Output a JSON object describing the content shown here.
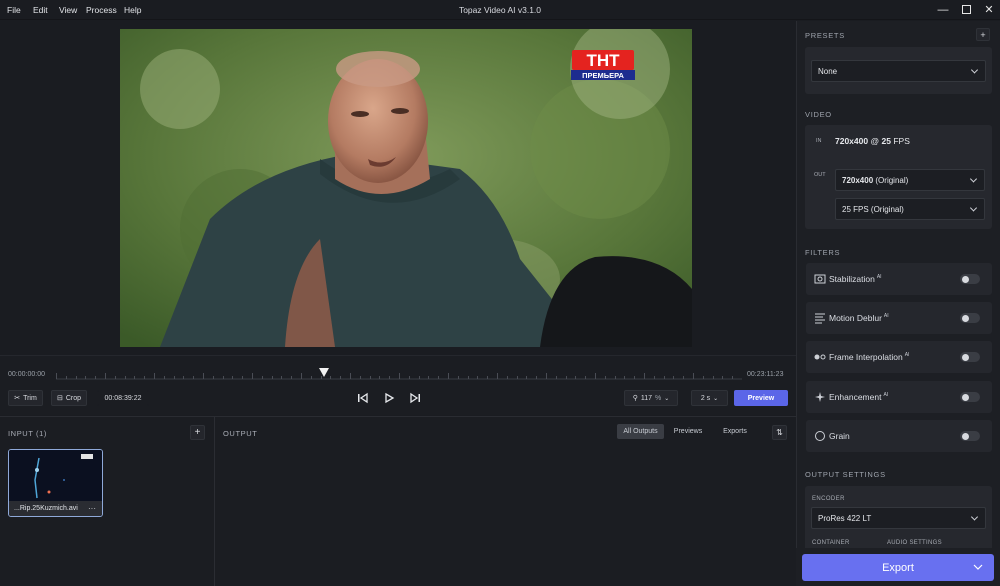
{
  "menu": {
    "file": "File",
    "edit": "Edit",
    "view": "View",
    "process": "Process",
    "help": "Help"
  },
  "app": {
    "title": "Topaz Video AI  v3.1.0"
  },
  "video_overlay": {
    "logo_text": "ТНТ",
    "logo_sub": "ПРЕМЬЕРА"
  },
  "timeline": {
    "start": "00:00:00:00",
    "end": "00:23:11:23",
    "playhead_fraction": 0.39
  },
  "toolbar": {
    "trim": "Trim",
    "crop": "Crop",
    "timecode": "00:08:39:22",
    "zoom": "117",
    "zoom_unit": "%",
    "duration": "2 s",
    "preview": "Preview"
  },
  "input": {
    "title": "INPUT (1)",
    "file_name": "...Rip.25Kuzmich.avi",
    "more": "···"
  },
  "output": {
    "title": "OUTPUT",
    "tabs": [
      "All Outputs",
      "Previews",
      "Exports"
    ]
  },
  "sidebar": {
    "presets": {
      "title": "PRESETS",
      "value": "None"
    },
    "video": {
      "title": "VIDEO",
      "in_label": "IN",
      "in_res": "720x400",
      "in_at": "@",
      "in_fps": "25",
      "in_fps_unit": "FPS",
      "out_label": "OUT",
      "out_res": "720x400",
      "out_res_note": "(Original)",
      "out_fps": "25 FPS (Original)"
    },
    "filters": {
      "title": "FILTERS",
      "items": [
        {
          "label": "Stabilization",
          "ai": "AI"
        },
        {
          "label": "Motion Deblur",
          "ai": "AI"
        },
        {
          "label": "Frame Interpolation",
          "ai": "AI"
        },
        {
          "label": "Enhancement",
          "ai": "AI"
        },
        {
          "label": "Grain",
          "ai": ""
        }
      ]
    },
    "output_settings": {
      "title": "OUTPUT SETTINGS",
      "encoder_label": "ENCODER",
      "encoder": "ProRes 422 LT",
      "container_label": "CONTAINER",
      "audio_label": "AUDIO SETTINGS"
    },
    "export": "Export"
  },
  "colors": {
    "accent": "#5b66e8",
    "export": "#6870f0"
  }
}
